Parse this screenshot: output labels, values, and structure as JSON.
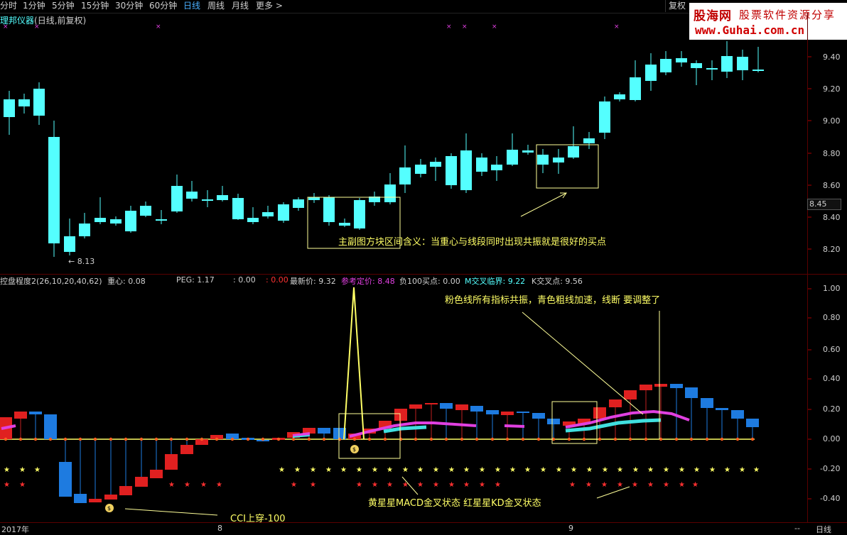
{
  "toolbar": {
    "periods": [
      "分时",
      "1分钟",
      "5分钟",
      "15分钟",
      "30分钟",
      "60分钟",
      "日线",
      "周线",
      "月线",
      "更多 >"
    ],
    "active_period": "日线",
    "restore_label": "复权"
  },
  "logo": {
    "line1": "股海网",
    "line2": "股票软件资源分享",
    "line3": "www.Guhai.com.cn"
  },
  "main_panel": {
    "title_name": "理邦仪器",
    "title_suffix": "(日线,前复权)",
    "y_ticks": [
      "9.40",
      "9.20",
      "9.00",
      "8.80",
      "8.60",
      "8.40",
      "8.20"
    ],
    "current_price_tag": "8.45",
    "low_marker": "8.13",
    "annotation": "主副图方块区间含义：当重心与线段同时出现共振就是很好的买点"
  },
  "sub_panel": {
    "indicator_name": "控盘程度2(26,10,20,40,62)",
    "stats": {
      "zhongxin": "重心: 0.08",
      "peg": "PEG: 1.17",
      "colon_val": ": 0.00",
      "red_val": ": 0.00",
      "latest": "最新价: 9.32",
      "ref_price": "参考定价: 8.48",
      "neg100": "负100买点: 0.00",
      "macd_cross": "M交叉临界: 9.22",
      "k_cross": "K交叉点: 9.56"
    },
    "y_ticks": [
      "1.00",
      "0.80",
      "0.60",
      "0.40",
      "0.20",
      "0.00",
      "-0.20",
      "-0.40"
    ],
    "annotation_top": "粉色线所有指标共振，青色粗线加速，线断 要调整了",
    "annotation_stars": "黄星星MACD金叉状态 红星星KD金叉状态",
    "annotation_cci": "CCI上穿-100"
  },
  "x_axis": {
    "labels": [
      "2017年",
      "8",
      "9"
    ],
    "right_label": "日线",
    "dash": "--"
  },
  "colors": {
    "up": "#ff3232",
    "down": "#54ffff",
    "pink": "#e040e0",
    "cyan": "#40e0e0",
    "yellow": "#ffff66",
    "bg": "#000000"
  }
}
